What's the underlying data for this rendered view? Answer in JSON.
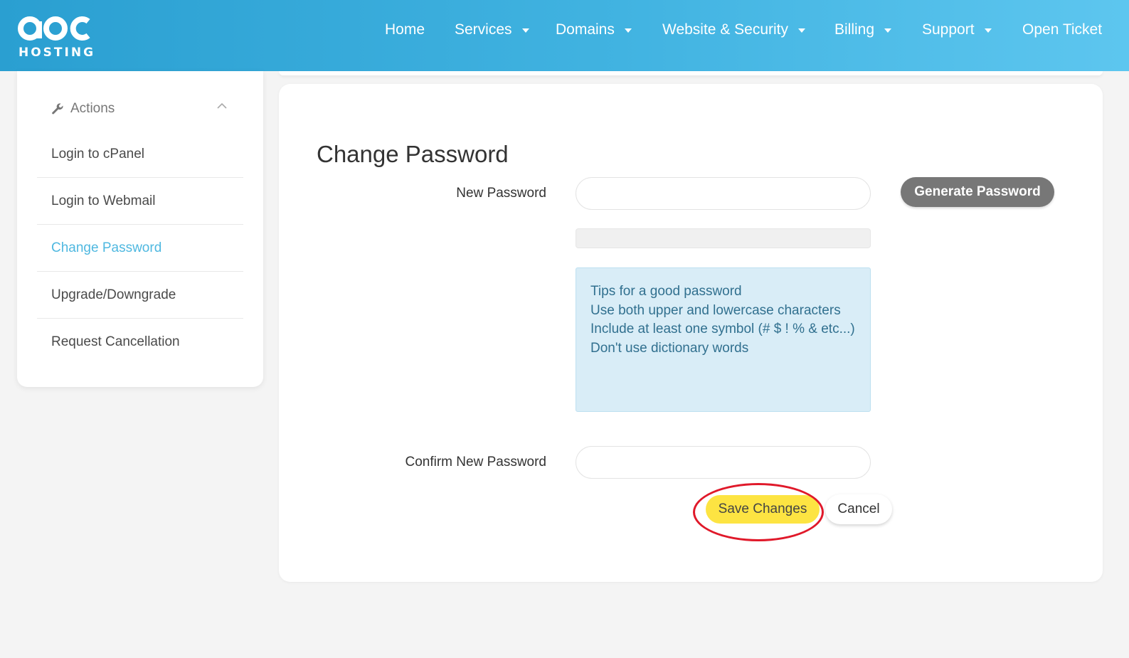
{
  "brand": {
    "logo_text": "HOSTING",
    "logo_mark": "apc-logo"
  },
  "nav": {
    "items": [
      {
        "label": "Home",
        "has_dropdown": false
      },
      {
        "label": "Services",
        "has_dropdown": true
      },
      {
        "label": "Domains",
        "has_dropdown": true
      },
      {
        "label": "Website & Security",
        "has_dropdown": true
      },
      {
        "label": "Billing",
        "has_dropdown": true
      },
      {
        "label": "Support",
        "has_dropdown": true
      },
      {
        "label": "Open Ticket",
        "has_dropdown": false
      }
    ]
  },
  "sidebar": {
    "heading": "Actions",
    "heading_icon": "wrench-icon",
    "collapse_icon": "chevron-up-icon",
    "items": [
      {
        "label": "Login to cPanel",
        "active": false
      },
      {
        "label": "Login to Webmail",
        "active": false
      },
      {
        "label": "Change Password",
        "active": true
      },
      {
        "label": "Upgrade/Downgrade",
        "active": false
      },
      {
        "label": "Request Cancellation",
        "active": false
      }
    ]
  },
  "main": {
    "title": "Change Password",
    "new_password": {
      "label": "New Password",
      "value": "",
      "placeholder": ""
    },
    "generate_button": "Generate Password",
    "tips": {
      "lines": [
        "Tips for a good password",
        "Use both upper and lowercase characters",
        "Include at least one symbol (# $ ! % & etc...)",
        "Don't use dictionary words"
      ]
    },
    "confirm_password": {
      "label": "Confirm New Password",
      "value": "",
      "placeholder": ""
    },
    "save_button": "Save Changes",
    "cancel_button": "Cancel"
  },
  "colors": {
    "header_start": "#2a9fd1",
    "header_end": "#5dc6ef",
    "active_link": "#4fb8e0",
    "save_button": "#fde442",
    "generate_button": "#777777",
    "tips_background": "#d9edf7",
    "tips_text": "#31708f",
    "highlight_ring": "#e0192a"
  }
}
